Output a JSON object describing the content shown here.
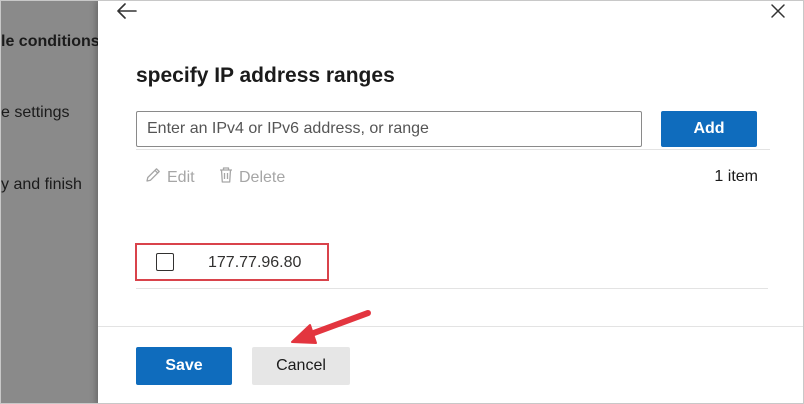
{
  "background": {
    "steps": [
      {
        "label": "le conditions",
        "bold": true
      },
      {
        "label": "e settings",
        "bold": false
      },
      {
        "label": "y and finish",
        "bold": false
      }
    ]
  },
  "panel": {
    "title": "specify IP address ranges",
    "input": {
      "placeholder": "Enter an IPv4 or IPv6 address, or range",
      "value": ""
    },
    "add_label": "Add",
    "toolbar": {
      "edit_label": "Edit",
      "delete_label": "Delete",
      "item_count": "1 item"
    },
    "items": [
      {
        "ip": "177.77.96.80",
        "checked": false
      }
    ],
    "save_label": "Save",
    "cancel_label": "Cancel"
  },
  "icons": {
    "back": "back-arrow-icon",
    "close": "close-icon",
    "edit": "pencil-icon",
    "delete": "trash-icon"
  },
  "colors": {
    "primary": "#0f6cbd",
    "highlight": "#d9434b",
    "disabled": "#a6a6a6",
    "overlay": "#8a8a8a"
  }
}
